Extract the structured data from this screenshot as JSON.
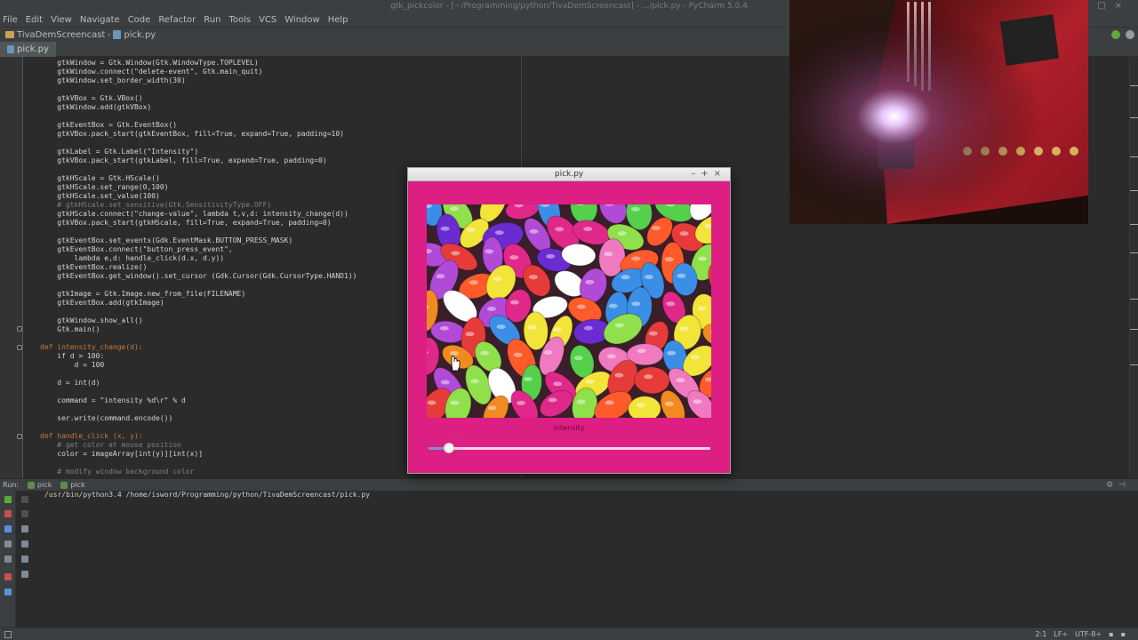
{
  "window": {
    "title": "gtk_pickcolor - [~/Programming/python/TivaDemScreencast] - .../pick.py - PyCharm 5.0.4"
  },
  "menu": [
    "File",
    "Edit",
    "View",
    "Navigate",
    "Code",
    "Refactor",
    "Run",
    "Tools",
    "VCS",
    "Window",
    "Help"
  ],
  "breadcrumb": {
    "project": "TivaDemScreencast",
    "file": "pick.py"
  },
  "tabs": [
    {
      "label": "pick.py",
      "active": true
    }
  ],
  "code_lines": [
    "    gtkWindow = Gtk.Window(Gtk.WindowType.TOPLEVEL)",
    "    gtkWindow.connect(\"delete-event\", Gtk.main_quit)",
    "    gtkWindow.set_border_width(30)",
    "",
    "    gtkVBox = Gtk.VBox()",
    "    gtkWindow.add(gtkVBox)",
    "",
    "    gtkEventBox = Gtk.EventBox()",
    "    gtkVBox.pack_start(gtkEventBox, fill=True, expand=True, padding=10)",
    "",
    "    gtkLabel = Gtk.Label(\"Intensity\")",
    "    gtkVBox.pack_start(gtkLabel, fill=True, expand=True, padding=0)",
    "",
    "    gtkHScale = Gtk.HScale()",
    "    gtkHScale.set_range(0,100)",
    "    gtkHScale.set_value(100)",
    "    # gtkHScale.set_sensitive(Gtk.SensitivityType.OFF)",
    "    gtkHScale.connect(\"change-value\", lambda t,v,d: intensity_change(d))",
    "    gtkVBox.pack_start(gtkHScale, fill=True, expand=True, padding=0)",
    "",
    "    gtkEventBox.set_events(Gdk.EventMask.BUTTON_PRESS_MASK)",
    "    gtkEventBox.connect(\"button_press_event\",",
    "        lambda e,d: handle_click(d.x, d.y))",
    "    gtkEventBox.realize()",
    "    gtkEventBox.get_window().set_cursor (Gdk.Cursor(Gdk.CursorType.HAND1))",
    "",
    "    gtkImage = Gtk.Image.new_from_file(FILENAME)",
    "    gtkEventBox.add(gtkImage)",
    "",
    "    gtkWindow.show_all()",
    "    Gtk.main()",
    "",
    "def intensity_change(d):",
    "    if d > 100:",
    "        d = 100",
    "",
    "    d = int(d)",
    "",
    "    command = \"intensity %d\\r\" % d",
    "",
    "    ser.write(command.encode())",
    "",
    "def handle_click (x, y):",
    "    # get color at mouse position",
    "    color = imageArray[int(y)][int(x)]",
    "",
    "    # modify window background color"
  ],
  "run_panel": {
    "label": "Run:",
    "tabs": [
      "pick",
      "pick"
    ],
    "output": "/usr/bin/python3.4 /home/isword/Programming/python/TivaDemScreencast/pick.py"
  },
  "status_bar": {
    "position": "2:1",
    "line_sep": "LF÷",
    "encoding": "UTF-8÷"
  },
  "gtk_window": {
    "title": "pick.py",
    "label": "Intensity",
    "scale_value_text": "7.4",
    "scale": {
      "min": 0,
      "max": 100,
      "value": 7.4
    },
    "background": "#dd1e83"
  },
  "colors": {
    "ide_bg": "#2b2b2b",
    "ide_chrome": "#3c3f41",
    "gtk_bg": "#dd1e83"
  },
  "icons": [
    "folder-icon",
    "python-file-icon",
    "minimize-icon",
    "maximize-icon",
    "close-icon",
    "rerun-icon",
    "stop-icon",
    "pause-icon",
    "settings-icon",
    "hand-cursor-icon"
  ]
}
